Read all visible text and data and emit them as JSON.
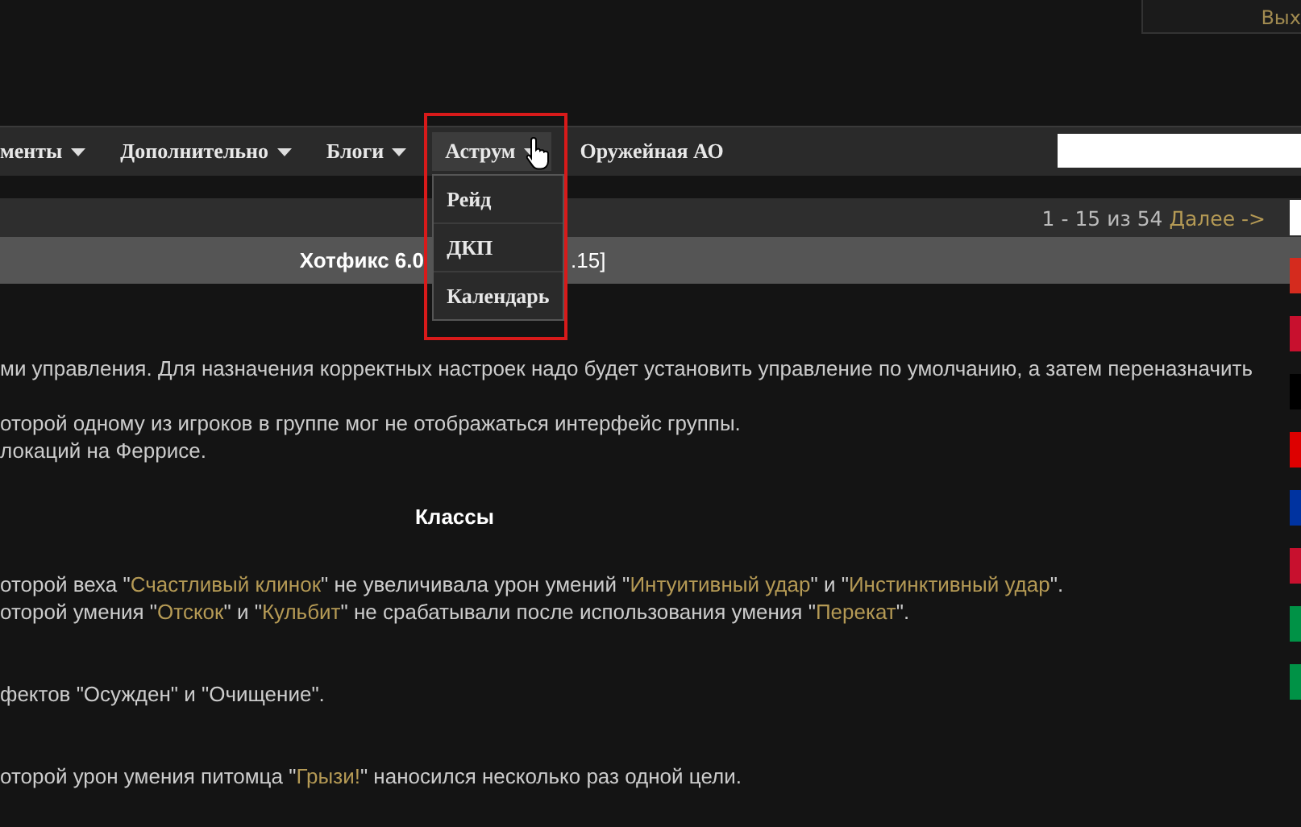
{
  "account_box": {
    "label": "Вых"
  },
  "nav": {
    "items": [
      {
        "label": "менты",
        "dropdown": true,
        "selected": false
      },
      {
        "label": "Дополнительно",
        "dropdown": true,
        "selected": false
      },
      {
        "label": "Блоги",
        "dropdown": true,
        "selected": false
      },
      {
        "label": "Аструм",
        "dropdown": true,
        "selected": true
      },
      {
        "label": "Оружейная АО",
        "dropdown": false,
        "selected": false
      }
    ],
    "menu": [
      {
        "label": "Рейд"
      },
      {
        "label": "ДКП"
      },
      {
        "label": "Календарь"
      }
    ]
  },
  "pagination": {
    "range": "1 - 15 из 54",
    "next": "Далее ->"
  },
  "post_title": {
    "left": "Хотфикс 6.0",
    "right": ".15]"
  },
  "content": [
    {
      "kind": "line",
      "parts": [
        {
          "text": "ми управления. Для назначения корректных настроек надо будет установить управление по умолчанию, а затем переназначить",
          "link": false
        }
      ]
    },
    {
      "kind": "gap"
    },
    {
      "kind": "line",
      "parts": [
        {
          "text": "оторой одному из игроков в группе мог не отображаться интерфейс группы.",
          "link": false
        }
      ]
    },
    {
      "kind": "line",
      "parts": [
        {
          "text": "локаций на Феррисе.",
          "link": false
        }
      ]
    },
    {
      "kind": "heading",
      "text": "Классы"
    },
    {
      "kind": "line",
      "parts": [
        {
          "text": "оторой веха \"",
          "link": false
        },
        {
          "text": "Счастливый клинок",
          "link": true
        },
        {
          "text": "\" не увеличивала урон умений \"",
          "link": false
        },
        {
          "text": "Интуитивный удар",
          "link": true
        },
        {
          "text": "\" и \"",
          "link": false
        },
        {
          "text": "Инстинктивный удар",
          "link": true
        },
        {
          "text": "\".",
          "link": false
        }
      ]
    },
    {
      "kind": "line",
      "parts": [
        {
          "text": "оторой умения \"",
          "link": false
        },
        {
          "text": "Отскок",
          "link": true
        },
        {
          "text": "\" и \"",
          "link": false
        },
        {
          "text": "Кульбит",
          "link": true
        },
        {
          "text": "\" не срабатывали после использования умения \"",
          "link": false
        },
        {
          "text": "Перекат",
          "link": true
        },
        {
          "text": "\".",
          "link": false
        }
      ]
    },
    {
      "kind": "gap2"
    },
    {
      "kind": "line",
      "parts": [
        {
          "text": "фектов \"Осужден\" и \"Очищение\".",
          "link": false
        }
      ]
    },
    {
      "kind": "gap2"
    },
    {
      "kind": "line",
      "parts": [
        {
          "text": "оторой урон умения питомца \"",
          "link": false
        },
        {
          "text": "Грызи!",
          "link": true
        },
        {
          "text": "\" наносился несколько раз одной цели.",
          "link": false
        }
      ]
    }
  ]
}
